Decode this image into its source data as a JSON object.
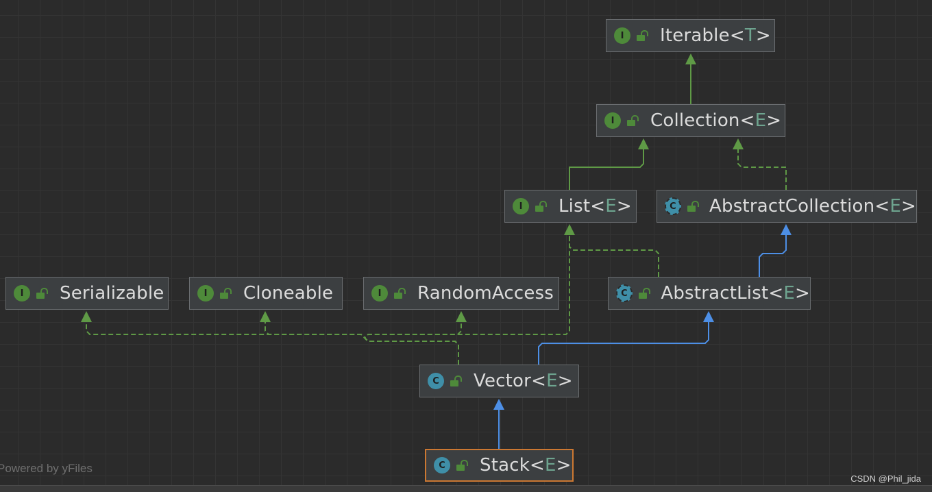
{
  "diagram": {
    "nodes": {
      "iterable": {
        "kind": "I",
        "type": "interface",
        "name": "Iterable",
        "param": "T"
      },
      "collection": {
        "kind": "I",
        "type": "interface",
        "name": "Collection",
        "param": "E"
      },
      "list": {
        "kind": "I",
        "type": "interface",
        "name": "List",
        "param": "E"
      },
      "abstract_collection": {
        "kind": "C",
        "type": "abstract-class",
        "name": "AbstractCollection",
        "param": "E"
      },
      "serializable": {
        "kind": "I",
        "type": "interface",
        "name": "Serializable",
        "param": ""
      },
      "cloneable": {
        "kind": "I",
        "type": "interface",
        "name": "Cloneable",
        "param": ""
      },
      "random_access": {
        "kind": "I",
        "type": "interface",
        "name": "RandomAccess",
        "param": ""
      },
      "abstract_list": {
        "kind": "C",
        "type": "abstract-class",
        "name": "AbstractList",
        "param": "E"
      },
      "vector": {
        "kind": "C",
        "type": "class",
        "name": "Vector",
        "param": "E"
      },
      "stack": {
        "kind": "C",
        "type": "class",
        "name": "Stack",
        "param": "E",
        "selected": true
      }
    },
    "edges": [
      {
        "from": "collection",
        "to": "iterable",
        "relation": "extends"
      },
      {
        "from": "list",
        "to": "collection",
        "relation": "extends"
      },
      {
        "from": "abstract_collection",
        "to": "collection",
        "relation": "implements"
      },
      {
        "from": "abstract_list",
        "to": "list",
        "relation": "implements"
      },
      {
        "from": "abstract_list",
        "to": "abstract_collection",
        "relation": "extends"
      },
      {
        "from": "vector",
        "to": "serializable",
        "relation": "implements"
      },
      {
        "from": "vector",
        "to": "cloneable",
        "relation": "implements"
      },
      {
        "from": "vector",
        "to": "random_access",
        "relation": "implements"
      },
      {
        "from": "vector",
        "to": "list",
        "relation": "implements"
      },
      {
        "from": "vector",
        "to": "abstract_list",
        "relation": "extends"
      },
      {
        "from": "stack",
        "to": "vector",
        "relation": "extends"
      }
    ],
    "colors": {
      "interface_edge": "#5f9a46",
      "class_edge": "#4d8fe6",
      "selected_border": "#cc7832"
    }
  },
  "footer": {
    "powered_by": "Powered by yFiles",
    "watermark": "CSDN @Phil_jida"
  }
}
